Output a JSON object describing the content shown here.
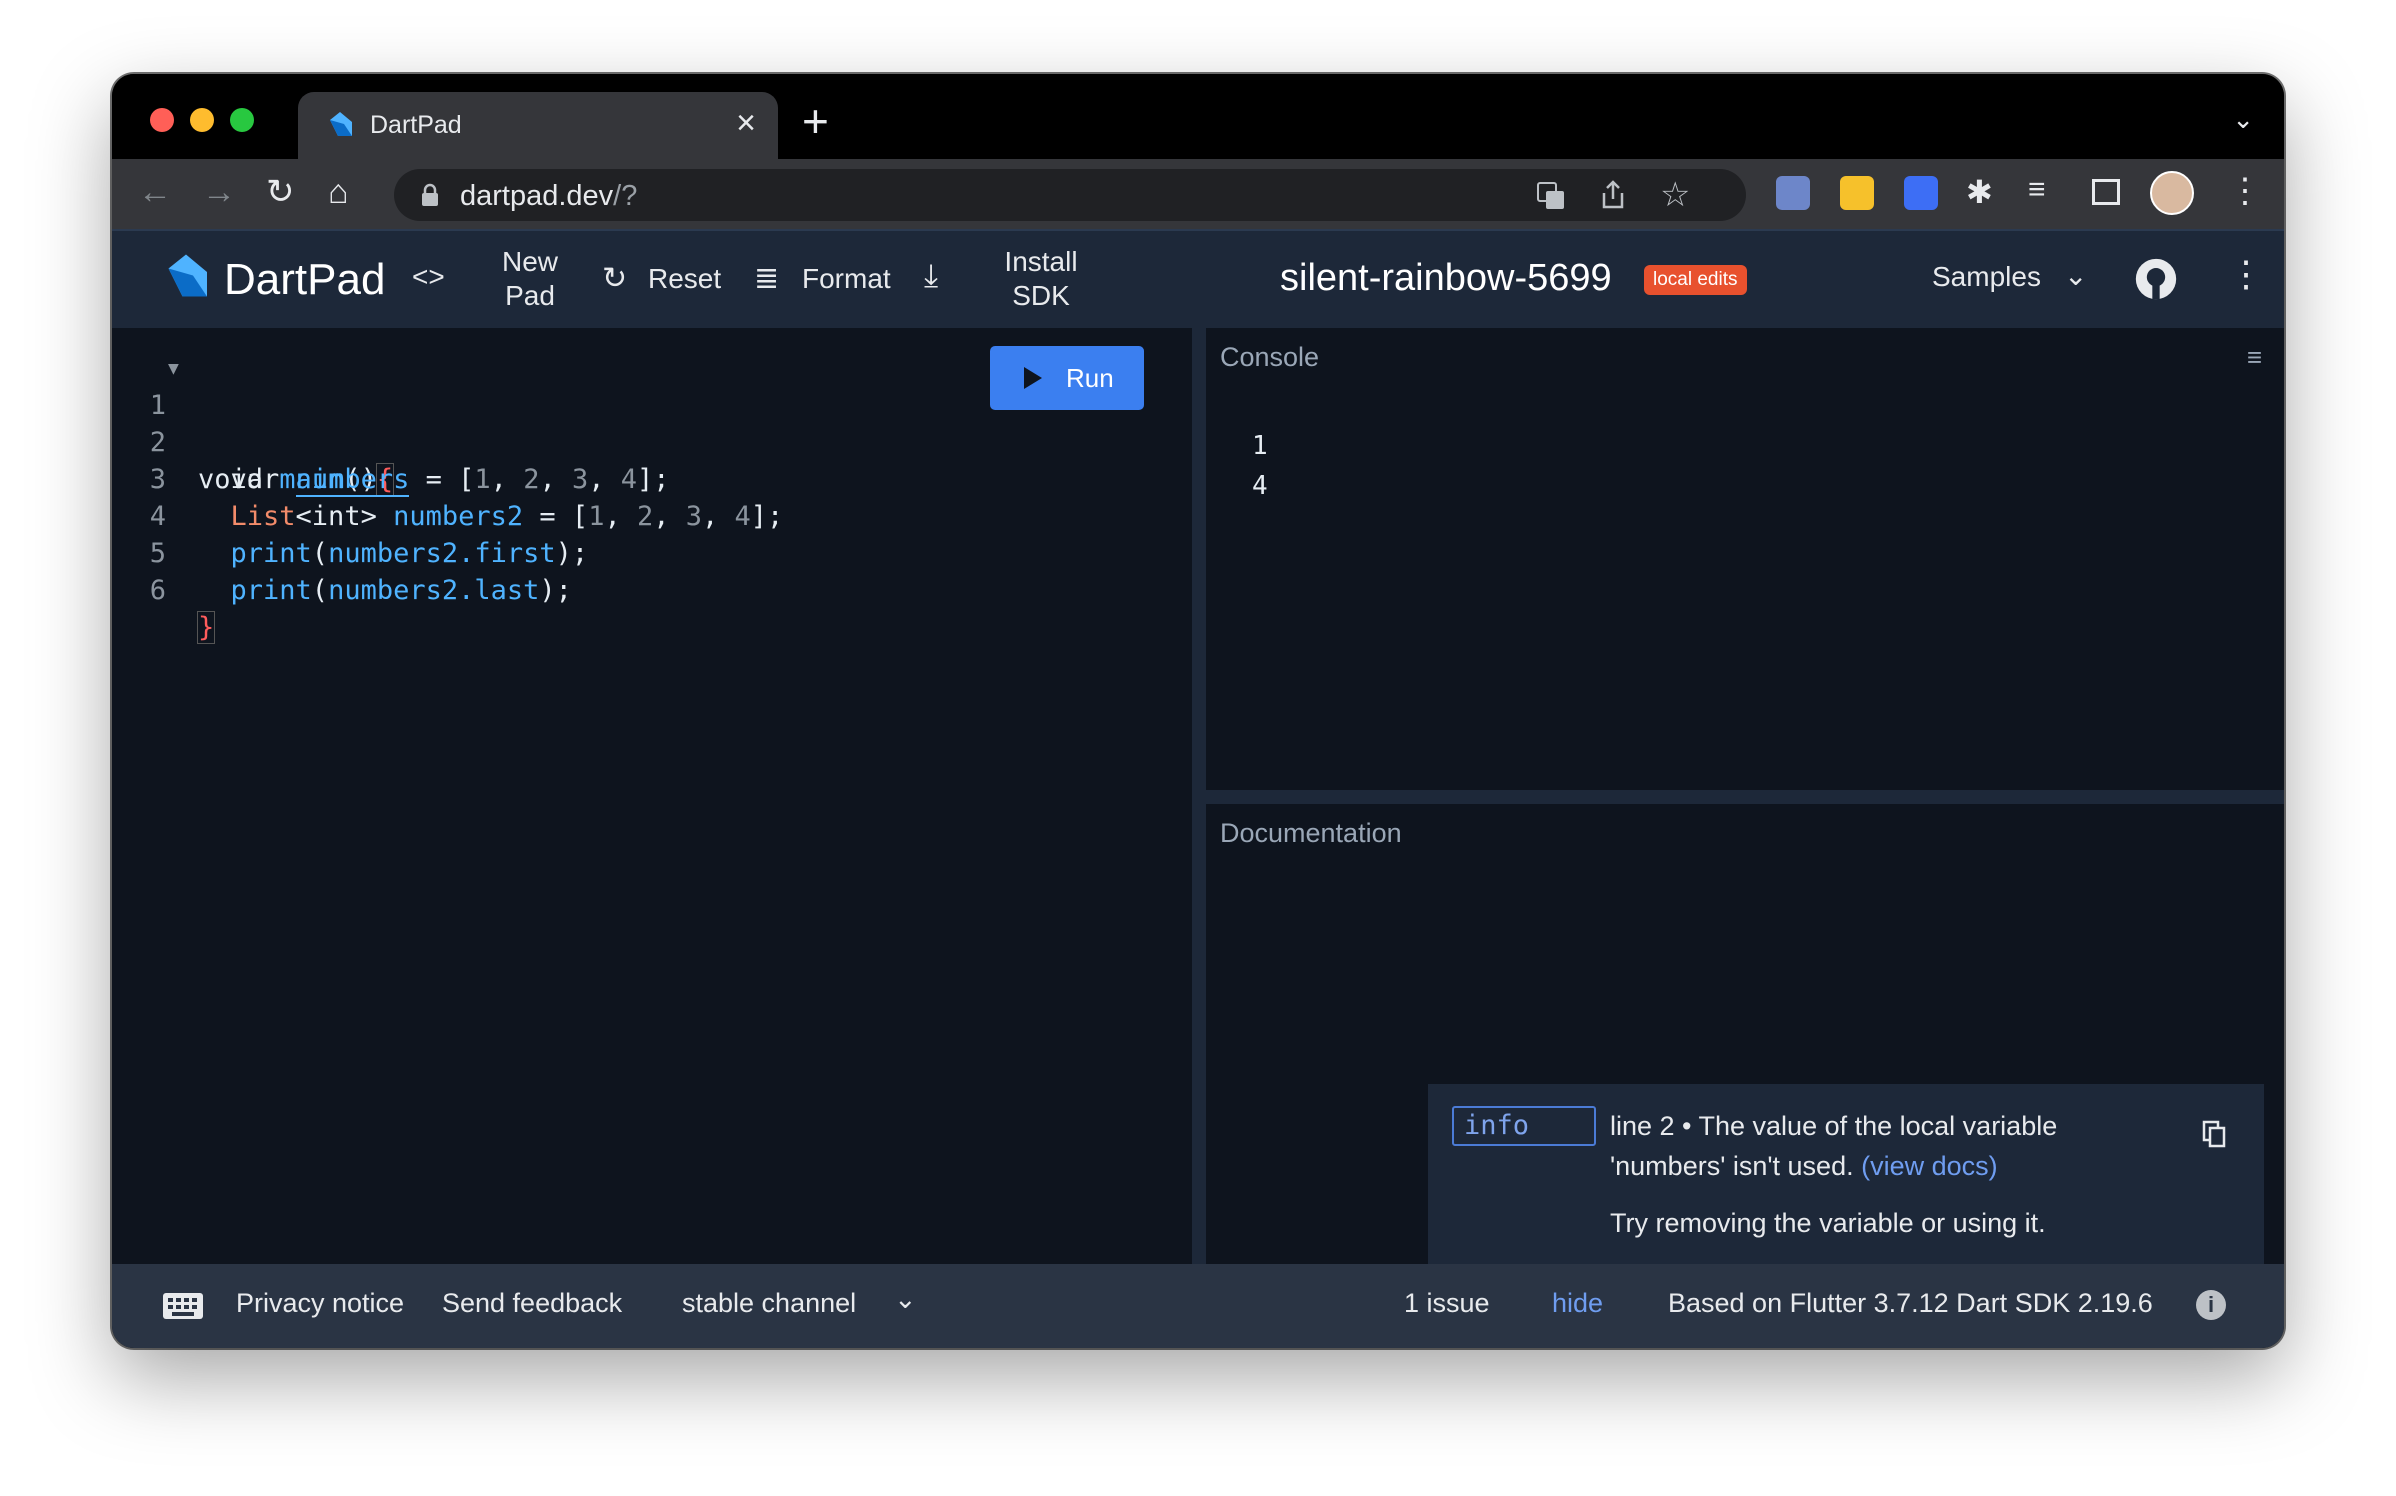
{
  "browser": {
    "tab_title": "DartPad",
    "tab_close": "×",
    "new_tab": "+",
    "tab_search": "⌄",
    "url_host": "dartpad.dev",
    "url_path": "/?",
    "nav": {
      "back": "←",
      "forward": "→",
      "reload": "↻",
      "home": "⌂"
    },
    "menu": "⋮"
  },
  "header": {
    "app_name": "DartPad",
    "embed_icon": "<>",
    "new_pad": [
      "New",
      "Pad"
    ],
    "reset": "Reset",
    "format": "Format",
    "install_sdk": [
      "Install",
      "SDK"
    ],
    "pad_name": "silent-rainbow-5699",
    "badge": "local edits",
    "samples": "Samples"
  },
  "editor": {
    "run_label": "Run",
    "lines": [
      {
        "n": "1"
      },
      {
        "n": "2"
      },
      {
        "n": "3"
      },
      {
        "n": "4"
      },
      {
        "n": "5"
      },
      {
        "n": "6"
      }
    ],
    "tokens": {
      "void": "void",
      "main": "main",
      "parens": "()",
      "lbrace": "{",
      "var": "var",
      "numbers": "numbers",
      "eq": " = ",
      "lb": "[",
      "n1": "1",
      "n2": "2",
      "n3": "3",
      "n4": "4",
      "comma": ", ",
      "rb": "];",
      "list": "List",
      "int": "<int>",
      "numbers2": "numbers2",
      "print": "print",
      "lp": "(",
      "first": "numbers2.first",
      "last": "numbers2.last",
      "rp": ");",
      "rbrace": "}"
    }
  },
  "console": {
    "title": "Console",
    "output": [
      "1",
      "4"
    ]
  },
  "docs": {
    "title": "Documentation"
  },
  "issue": {
    "tag": "info",
    "message": "line 2 • The value of the local variable 'numbers' isn't used.",
    "link": "(view docs)",
    "hint": "Try removing the variable or using it."
  },
  "status": {
    "privacy": "Privacy notice",
    "feedback": "Send feedback",
    "channel": "stable channel",
    "issues": "1 issue",
    "hide": "hide",
    "version": "Based on Flutter 3.7.12 Dart SDK 2.19.6"
  },
  "colors": {
    "accent": "#3b7ff0",
    "badge": "#e8512e",
    "editor_bg": "#0e141e",
    "header_bg": "#1d2839"
  }
}
